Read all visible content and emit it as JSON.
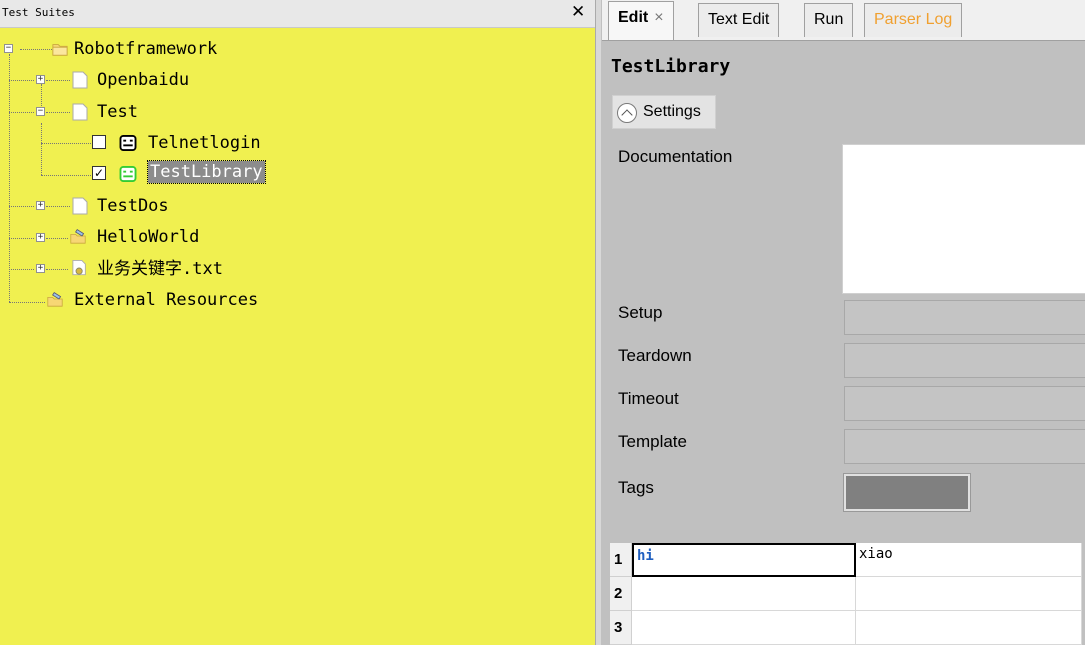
{
  "left_panel": {
    "title": "Test Suites",
    "close_glyph": "✕",
    "tree": {
      "root": "Robotframework",
      "openbaidu": "Openbaidu",
      "test": "Test",
      "telnetlogin": "Telnetlogin",
      "testlibrary": "TestLibrary",
      "testdos": "TestDos",
      "helloworld": "HelloWorld",
      "keyword_file": "业务关键字.txt",
      "external": "External Resources",
      "expander_plus": "+",
      "expander_minus": "−",
      "checked_glyph": "✓"
    }
  },
  "right_panel": {
    "tabs": [
      {
        "label": "Edit",
        "close": "×"
      },
      {
        "label": "Text Edit"
      },
      {
        "label": "Run"
      },
      {
        "label": "Parser Log"
      }
    ],
    "title": "TestLibrary",
    "settings_label": "Settings",
    "fields": {
      "documentation": "Documentation",
      "setup": "Setup",
      "teardown": "Teardown",
      "timeout": "Timeout",
      "template": "Template",
      "tags": "Tags"
    },
    "grid": {
      "rows": [
        {
          "num": "1",
          "c1": "hi",
          "c2": "xiao"
        },
        {
          "num": "2",
          "c1": "",
          "c2": ""
        },
        {
          "num": "3",
          "c1": "",
          "c2": ""
        }
      ]
    }
  },
  "colors": {
    "tree_background": "#f0f050",
    "selected_node": "#8c8c8c",
    "parser_log_tab": "#f0a030",
    "robot_active": "#33cc33",
    "keyword_blue": "#1f5fc0"
  },
  "icons": {
    "folder": "folder-icon",
    "file": "file-icon",
    "robot": "robot-icon",
    "resource": "resource-icon",
    "settings_toggle": "collapse-icon"
  }
}
